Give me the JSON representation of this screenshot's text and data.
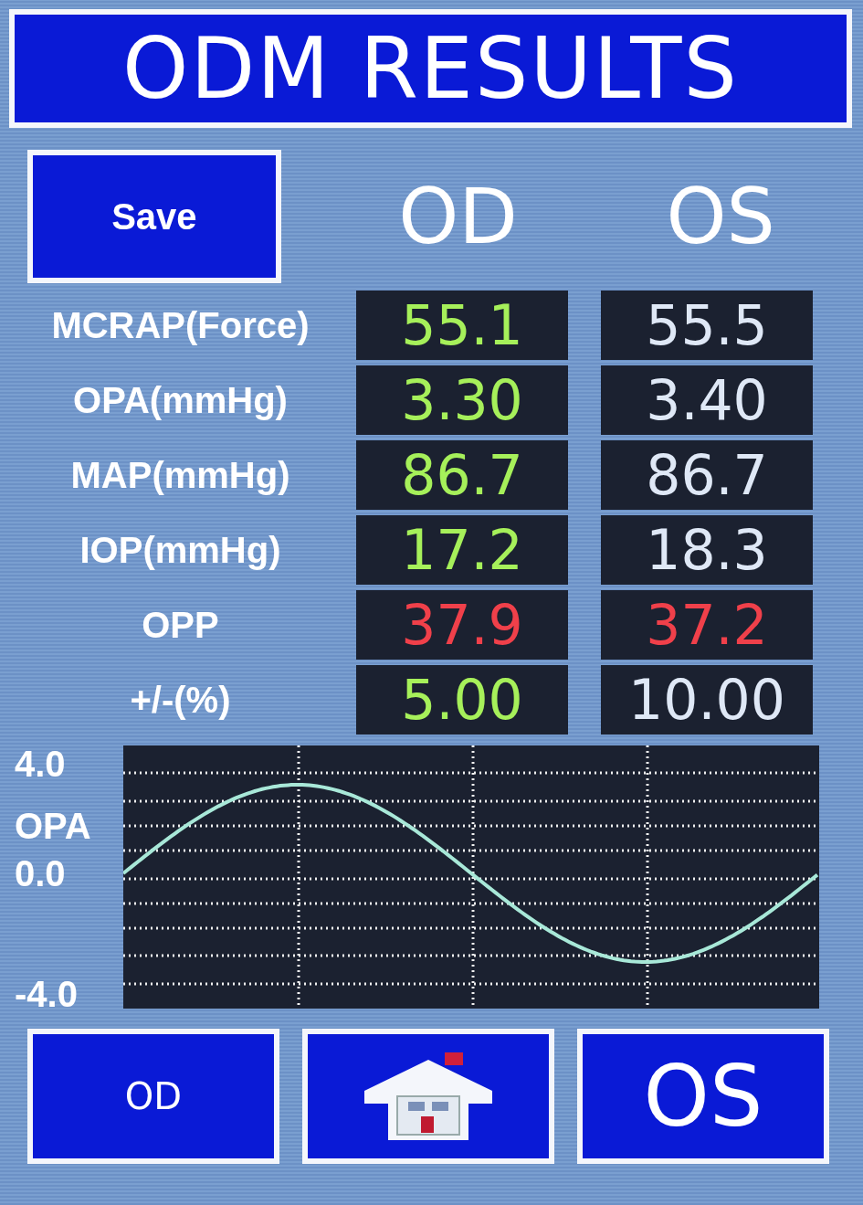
{
  "title": "ODM RESULTS",
  "save_button": "Save",
  "columns": [
    "OD",
    "OS"
  ],
  "rows": [
    {
      "label": "MCRAP(Force)",
      "od": {
        "value": "55.1",
        "alert": false
      },
      "os": {
        "value": "55.5",
        "alert": false
      }
    },
    {
      "label": "OPA(mmHg)",
      "od": {
        "value": "3.30",
        "alert": false
      },
      "os": {
        "value": "3.40",
        "alert": false
      }
    },
    {
      "label": "MAP(mmHg)",
      "od": {
        "value": "86.7",
        "alert": false
      },
      "os": {
        "value": "86.7",
        "alert": false
      }
    },
    {
      "label": "IOP(mmHg)",
      "od": {
        "value": "17.2",
        "alert": false
      },
      "os": {
        "value": "18.3",
        "alert": false
      }
    },
    {
      "label": "OPP",
      "od": {
        "value": "37.9",
        "alert": true
      },
      "os": {
        "value": "37.2",
        "alert": true
      }
    },
    {
      "label": "+/-(%)",
      "od": {
        "value": "5.00",
        "alert": false
      },
      "os": {
        "value": "10.00",
        "alert": false
      }
    }
  ],
  "chart": {
    "axis_labels": [
      "4.0",
      "OPA",
      "0.0",
      "-4.0"
    ]
  },
  "nav_buttons": [
    {
      "kind": "small",
      "label": "OD"
    },
    {
      "kind": "home"
    },
    {
      "kind": "large",
      "label": "OS"
    }
  ]
}
